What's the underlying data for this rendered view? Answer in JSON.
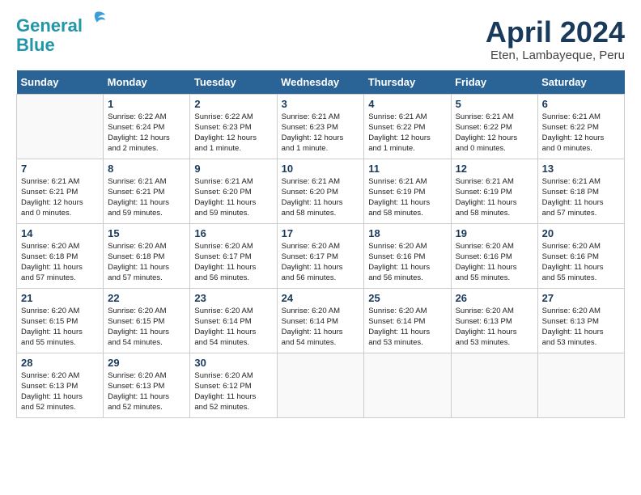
{
  "header": {
    "logo_line1": "General",
    "logo_line2": "Blue",
    "month_title": "April 2024",
    "location": "Eten, Lambayeque, Peru"
  },
  "days_of_week": [
    "Sunday",
    "Monday",
    "Tuesday",
    "Wednesday",
    "Thursday",
    "Friday",
    "Saturday"
  ],
  "weeks": [
    [
      {
        "day": "",
        "info": ""
      },
      {
        "day": "1",
        "info": "Sunrise: 6:22 AM\nSunset: 6:24 PM\nDaylight: 12 hours\nand 2 minutes."
      },
      {
        "day": "2",
        "info": "Sunrise: 6:22 AM\nSunset: 6:23 PM\nDaylight: 12 hours\nand 1 minute."
      },
      {
        "day": "3",
        "info": "Sunrise: 6:21 AM\nSunset: 6:23 PM\nDaylight: 12 hours\nand 1 minute."
      },
      {
        "day": "4",
        "info": "Sunrise: 6:21 AM\nSunset: 6:22 PM\nDaylight: 12 hours\nand 1 minute."
      },
      {
        "day": "5",
        "info": "Sunrise: 6:21 AM\nSunset: 6:22 PM\nDaylight: 12 hours\nand 0 minutes."
      },
      {
        "day": "6",
        "info": "Sunrise: 6:21 AM\nSunset: 6:22 PM\nDaylight: 12 hours\nand 0 minutes."
      }
    ],
    [
      {
        "day": "7",
        "info": "Sunrise: 6:21 AM\nSunset: 6:21 PM\nDaylight: 12 hours\nand 0 minutes."
      },
      {
        "day": "8",
        "info": "Sunrise: 6:21 AM\nSunset: 6:21 PM\nDaylight: 11 hours\nand 59 minutes."
      },
      {
        "day": "9",
        "info": "Sunrise: 6:21 AM\nSunset: 6:20 PM\nDaylight: 11 hours\nand 59 minutes."
      },
      {
        "day": "10",
        "info": "Sunrise: 6:21 AM\nSunset: 6:20 PM\nDaylight: 11 hours\nand 58 minutes."
      },
      {
        "day": "11",
        "info": "Sunrise: 6:21 AM\nSunset: 6:19 PM\nDaylight: 11 hours\nand 58 minutes."
      },
      {
        "day": "12",
        "info": "Sunrise: 6:21 AM\nSunset: 6:19 PM\nDaylight: 11 hours\nand 58 minutes."
      },
      {
        "day": "13",
        "info": "Sunrise: 6:21 AM\nSunset: 6:18 PM\nDaylight: 11 hours\nand 57 minutes."
      }
    ],
    [
      {
        "day": "14",
        "info": "Sunrise: 6:20 AM\nSunset: 6:18 PM\nDaylight: 11 hours\nand 57 minutes."
      },
      {
        "day": "15",
        "info": "Sunrise: 6:20 AM\nSunset: 6:18 PM\nDaylight: 11 hours\nand 57 minutes."
      },
      {
        "day": "16",
        "info": "Sunrise: 6:20 AM\nSunset: 6:17 PM\nDaylight: 11 hours\nand 56 minutes."
      },
      {
        "day": "17",
        "info": "Sunrise: 6:20 AM\nSunset: 6:17 PM\nDaylight: 11 hours\nand 56 minutes."
      },
      {
        "day": "18",
        "info": "Sunrise: 6:20 AM\nSunset: 6:16 PM\nDaylight: 11 hours\nand 56 minutes."
      },
      {
        "day": "19",
        "info": "Sunrise: 6:20 AM\nSunset: 6:16 PM\nDaylight: 11 hours\nand 55 minutes."
      },
      {
        "day": "20",
        "info": "Sunrise: 6:20 AM\nSunset: 6:16 PM\nDaylight: 11 hours\nand 55 minutes."
      }
    ],
    [
      {
        "day": "21",
        "info": "Sunrise: 6:20 AM\nSunset: 6:15 PM\nDaylight: 11 hours\nand 55 minutes."
      },
      {
        "day": "22",
        "info": "Sunrise: 6:20 AM\nSunset: 6:15 PM\nDaylight: 11 hours\nand 54 minutes."
      },
      {
        "day": "23",
        "info": "Sunrise: 6:20 AM\nSunset: 6:14 PM\nDaylight: 11 hours\nand 54 minutes."
      },
      {
        "day": "24",
        "info": "Sunrise: 6:20 AM\nSunset: 6:14 PM\nDaylight: 11 hours\nand 54 minutes."
      },
      {
        "day": "25",
        "info": "Sunrise: 6:20 AM\nSunset: 6:14 PM\nDaylight: 11 hours\nand 53 minutes."
      },
      {
        "day": "26",
        "info": "Sunrise: 6:20 AM\nSunset: 6:13 PM\nDaylight: 11 hours\nand 53 minutes."
      },
      {
        "day": "27",
        "info": "Sunrise: 6:20 AM\nSunset: 6:13 PM\nDaylight: 11 hours\nand 53 minutes."
      }
    ],
    [
      {
        "day": "28",
        "info": "Sunrise: 6:20 AM\nSunset: 6:13 PM\nDaylight: 11 hours\nand 52 minutes."
      },
      {
        "day": "29",
        "info": "Sunrise: 6:20 AM\nSunset: 6:13 PM\nDaylight: 11 hours\nand 52 minutes."
      },
      {
        "day": "30",
        "info": "Sunrise: 6:20 AM\nSunset: 6:12 PM\nDaylight: 11 hours\nand 52 minutes."
      },
      {
        "day": "",
        "info": ""
      },
      {
        "day": "",
        "info": ""
      },
      {
        "day": "",
        "info": ""
      },
      {
        "day": "",
        "info": ""
      }
    ]
  ]
}
